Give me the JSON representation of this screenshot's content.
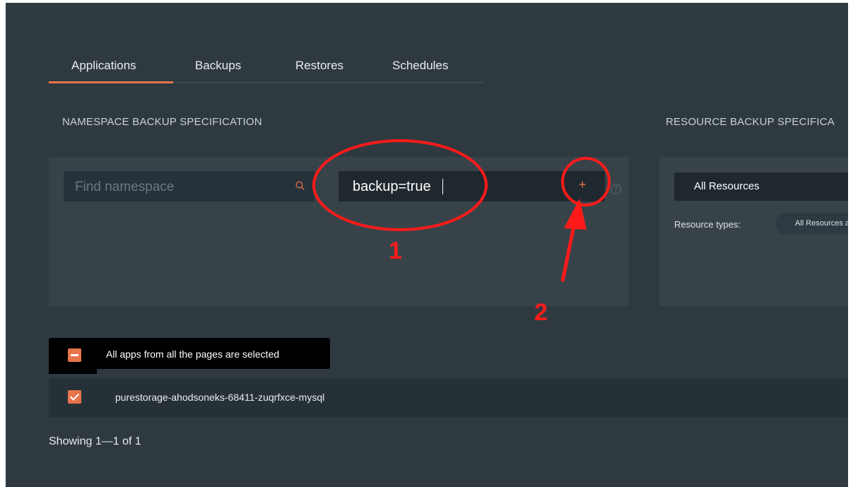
{
  "tabs": [
    {
      "label": "Applications",
      "active": true
    },
    {
      "label": "Backups"
    },
    {
      "label": "Restores"
    },
    {
      "label": "Schedules"
    }
  ],
  "namespace_section": {
    "title": "NAMESPACE BACKUP SPECIFICATION",
    "search": {
      "placeholder": "Find namespace",
      "icon": "search-icon"
    },
    "label_filter": {
      "value": "backup=true",
      "add_icon": "plus-icon",
      "help_icon": "help-icon"
    }
  },
  "resource_section": {
    "title": "RESOURCE BACKUP SPECIFICA",
    "select_value": "All Resources",
    "types_label": "Resource types:",
    "types_pill": "All Resources a"
  },
  "bulk_select": {
    "text": "All apps from all the pages are selected"
  },
  "apps": [
    {
      "name": "purestorage-ahodsoneks-68411-zuqrfxce-mysql",
      "checked": true
    }
  ],
  "pagination": {
    "text": "Showing 1—1 of 1"
  },
  "annotations": {
    "step1": "1",
    "step2": "2"
  },
  "colors": {
    "accent": "#e8744a",
    "background": "#2f3a40",
    "annotation": "#ff1a1a"
  }
}
